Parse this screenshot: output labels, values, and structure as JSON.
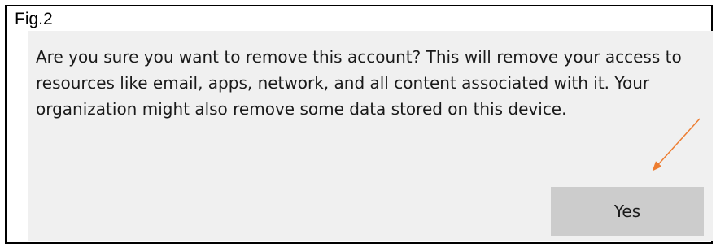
{
  "figure": {
    "label": "Fig.2"
  },
  "dialog": {
    "message": "Are you sure you want to remove this account? This will remove your access to resources like email, apps, network, and all content associated with it. Your organization might also remove some data stored on this device.",
    "yes_label": "Yes"
  },
  "annotation": {
    "type": "arrow",
    "color": "#ed7d31",
    "points_to": "yes-button"
  }
}
